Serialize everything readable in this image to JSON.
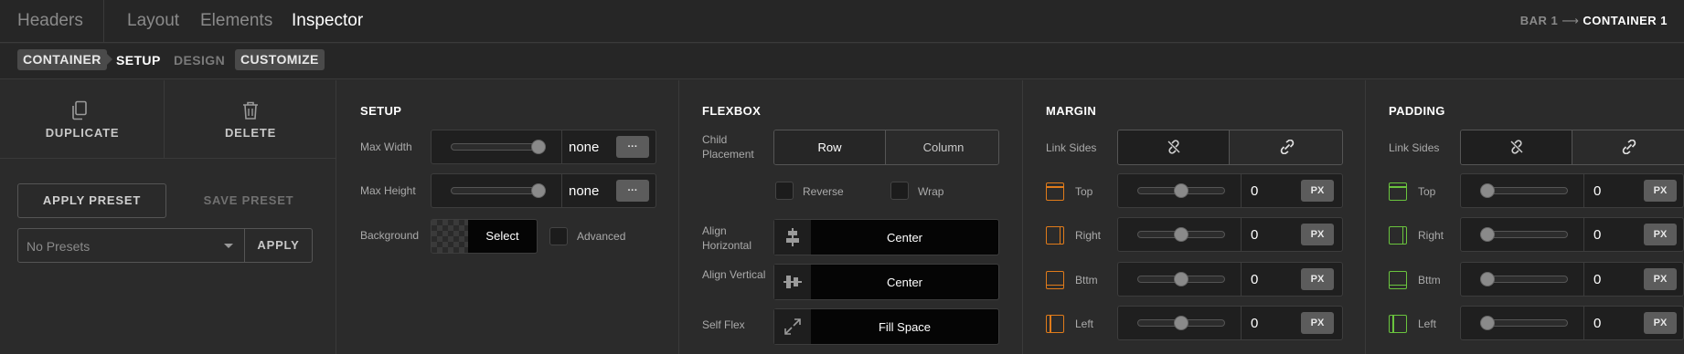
{
  "topbar": {
    "tabs": [
      {
        "label": "Headers",
        "active": false
      },
      {
        "label": "Layout",
        "active": false
      },
      {
        "label": "Elements",
        "active": false
      },
      {
        "label": "Inspector",
        "active": true
      }
    ],
    "breadcrumb": {
      "parent": "BAR 1",
      "arrow": "⟶",
      "current": "CONTAINER 1"
    }
  },
  "subbar": {
    "element": "CONTAINER",
    "tabs": [
      "SETUP",
      "DESIGN",
      "CUSTOMIZE"
    ]
  },
  "actions": {
    "duplicate": "DUPLICATE",
    "delete": "DELETE",
    "apply_preset": "APPLY PRESET",
    "save_preset": "SAVE PRESET",
    "preset_select": "No Presets",
    "apply": "APPLY"
  },
  "setup": {
    "title": "SETUP",
    "max_width_label": "Max Width",
    "max_width_value": "none",
    "max_width_slider": 1.0,
    "max_height_label": "Max Height",
    "max_height_value": "none",
    "max_height_slider": 1.0,
    "more": "···",
    "background_label": "Background",
    "background_select": "Select",
    "advanced_label": "Advanced",
    "advanced_checked": false
  },
  "flexbox": {
    "title": "FLEXBOX",
    "child_placement_label": "Child Placement",
    "row": "Row",
    "column": "Column",
    "selected": "Row",
    "reverse_label": "Reverse",
    "reverse_checked": false,
    "wrap_label": "Wrap",
    "wrap_checked": false,
    "align_horizontal_label": "Align Horizontal",
    "align_horizontal_value": "Center",
    "align_vertical_label": "Align Vertical",
    "align_vertical_value": "Center",
    "self_flex_label": "Self Flex",
    "self_flex_value": "Fill Space"
  },
  "margin": {
    "title": "MARGIN",
    "link_sides_label": "Link Sides",
    "icon_color": "#e07b1a",
    "unit": "PX",
    "sides": [
      {
        "label": "Top",
        "value": "0",
        "slider": 0.5
      },
      {
        "label": "Right",
        "value": "0",
        "slider": 0.5
      },
      {
        "label": "Bttm",
        "value": "0",
        "slider": 0.5
      },
      {
        "label": "Left",
        "value": "0",
        "slider": 0.5
      }
    ]
  },
  "padding": {
    "title": "PADDING",
    "link_sides_label": "Link Sides",
    "icon_color": "#6ac43e",
    "unit": "PX",
    "sides": [
      {
        "label": "Top",
        "value": "0",
        "slider": 0.0
      },
      {
        "label": "Right",
        "value": "0",
        "slider": 0.0
      },
      {
        "label": "Bttm",
        "value": "0",
        "slider": 0.0
      },
      {
        "label": "Left",
        "value": "0",
        "slider": 0.0
      }
    ]
  }
}
